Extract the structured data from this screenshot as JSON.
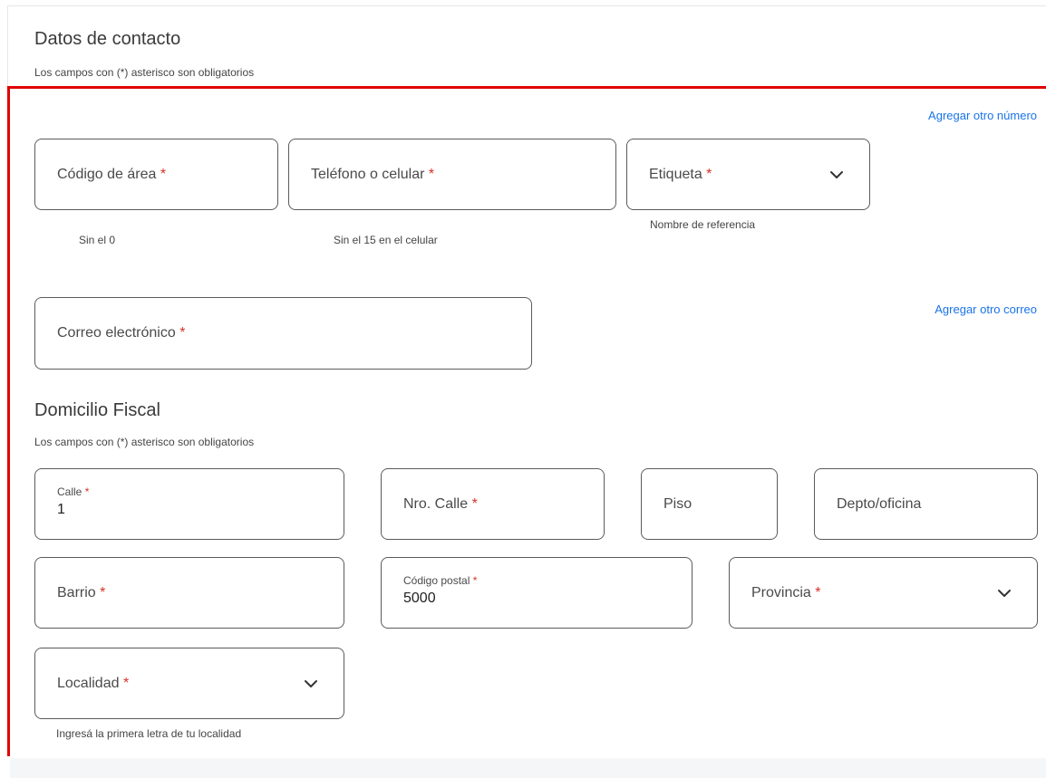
{
  "contact": {
    "title": "Datos de contacto",
    "subtitle": "Los campos con (*) asterisco son obligatorios",
    "add_number_link": "Agregar otro número",
    "add_email_link": "Agregar otro correo",
    "area_code": {
      "label": "Código de área",
      "required_mark": "*",
      "helper": "Sin el 0"
    },
    "phone": {
      "label": "Teléfono o celular",
      "required_mark": "*",
      "helper": "Sin el 15 en el celular"
    },
    "tag": {
      "label": "Etiqueta",
      "required_mark": "*",
      "helper": "Nombre de referencia"
    },
    "email": {
      "label": "Correo electrónico",
      "required_mark": "*"
    }
  },
  "fiscal": {
    "title": "Domicilio Fiscal",
    "subtitle": "Los campos con (*) asterisco son obligatorios",
    "street": {
      "label": "Calle",
      "required_mark": "*",
      "value": "1"
    },
    "street_number": {
      "label": "Nro. Calle",
      "required_mark": "*"
    },
    "floor": {
      "label": "Piso"
    },
    "apartment": {
      "label": "Depto/oficina"
    },
    "neighborhood": {
      "label": "Barrio",
      "required_mark": "*"
    },
    "postal_code": {
      "label": "Código postal",
      "required_mark": "*",
      "value": "5000"
    },
    "province": {
      "label": "Provincia",
      "required_mark": "*"
    },
    "locality": {
      "label": "Localidad",
      "required_mark": "*",
      "helper": "Ingresá la primera letra de tu localidad"
    }
  },
  "colors": {
    "highlight": "#e00000",
    "link": "#1a73e8",
    "required": "#d93025",
    "border": "#5b5b5b"
  }
}
